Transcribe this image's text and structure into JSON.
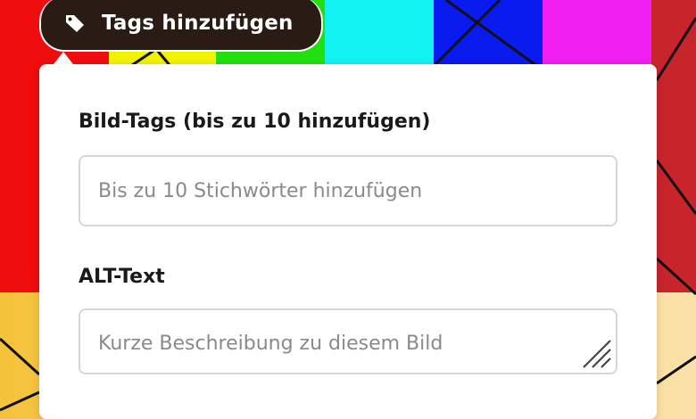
{
  "tag_button": {
    "label": "Tags hinzufügen",
    "icon": "tag-icon"
  },
  "tags_field": {
    "label": "Bild-Tags (bis zu 10 hinzufügen)",
    "placeholder": "Bis zu 10 Stichwörter hinzufügen",
    "value": ""
  },
  "alt_field": {
    "label": "ALT-Text",
    "placeholder": "Kurze Beschreibung zu diesem Bild",
    "value": ""
  },
  "colors": {
    "pill_bg": "#2a1b14",
    "background_bars": [
      "#ff0000",
      "#ffff00",
      "#00ff00",
      "#00ffff",
      "#0000ff",
      "#ff00ff",
      "#c8242c"
    ]
  }
}
